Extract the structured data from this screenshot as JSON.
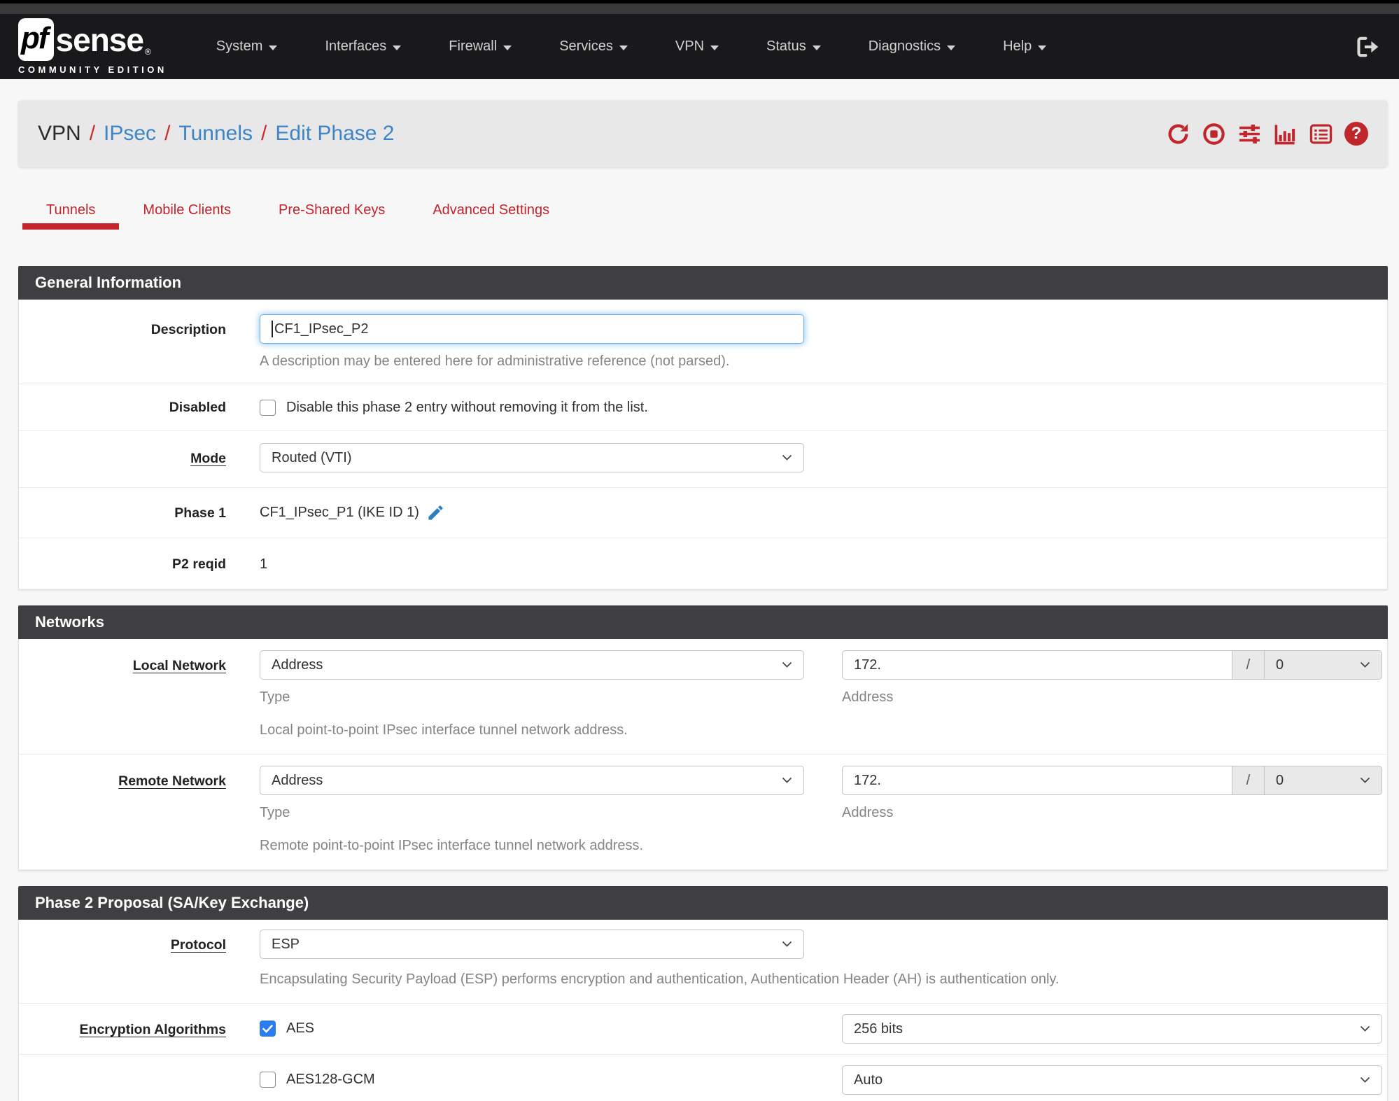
{
  "navbar": {
    "logo_pf": "pf",
    "logo_sense": "sense",
    "logo_reg": "®",
    "logo_subtitle": "COMMUNITY EDITION",
    "items": [
      "System",
      "Interfaces",
      "Firewall",
      "Services",
      "VPN",
      "Status",
      "Diagnostics",
      "Help"
    ]
  },
  "breadcrumb": {
    "root": "VPN",
    "sep": "/",
    "links": [
      "IPsec",
      "Tunnels",
      "Edit Phase 2"
    ]
  },
  "tabs": [
    "Tunnels",
    "Mobile Clients",
    "Pre-Shared Keys",
    "Advanced Settings"
  ],
  "icons": {
    "help_glyph": "?",
    "breadcrumb_icons": [
      "refresh-icon",
      "stop-icon",
      "sliders-icon",
      "bar-chart-icon",
      "list-icon",
      "help-icon"
    ],
    "navbar_right_icon": "sign-out-icon"
  },
  "general": {
    "title": "General Information",
    "description_label": "Description",
    "description_value": "CF1_IPsec_P2",
    "description_help": "A description may be entered here for administrative reference (not parsed).",
    "disabled_label": "Disabled",
    "disabled_text": "Disable this phase 2 entry without removing it from the list.",
    "disabled_checked": false,
    "mode_label": "Mode",
    "mode_value": "Routed (VTI)",
    "phase1_label": "Phase 1",
    "phase1_value": "CF1_IPsec_P1 (IKE ID 1)",
    "p2reqid_label": "P2 reqid",
    "p2reqid_value": "1"
  },
  "networks": {
    "title": "Networks",
    "local": {
      "label": "Local Network",
      "type_value": "Address",
      "type_help": "Type",
      "address_value": "172.",
      "cidr_sep": "/",
      "cidr_value": "0",
      "address_help": "Address",
      "description": "Local point-to-point IPsec interface tunnel network address."
    },
    "remote": {
      "label": "Remote Network",
      "type_value": "Address",
      "type_help": "Type",
      "address_value": "172.",
      "cidr_sep": "/",
      "cidr_value": "0",
      "address_help": "Address",
      "description": "Remote point-to-point IPsec interface tunnel network address."
    }
  },
  "proposal": {
    "title": "Phase 2 Proposal (SA/Key Exchange)",
    "protocol_label": "Protocol",
    "protocol_value": "ESP",
    "protocol_help": "Encapsulating Security Payload (ESP) performs encryption and authentication, Authentication Header (AH) is authentication only.",
    "enc_label": "Encryption Algorithms",
    "algorithms": [
      {
        "name": "AES",
        "checked": true,
        "keylen": "256 bits"
      },
      {
        "name": "AES128-GCM",
        "checked": false,
        "keylen": "Auto"
      }
    ]
  },
  "colors": {
    "brand_red": "#c0262c",
    "tab_red": "#c4232b",
    "link_blue": "#3d85c6",
    "focus_blue": "#66afe9",
    "checkbox_blue": "#2a7cf0",
    "navbar_bg": "#19191b",
    "panel_header_bg": "#3f3f41"
  }
}
